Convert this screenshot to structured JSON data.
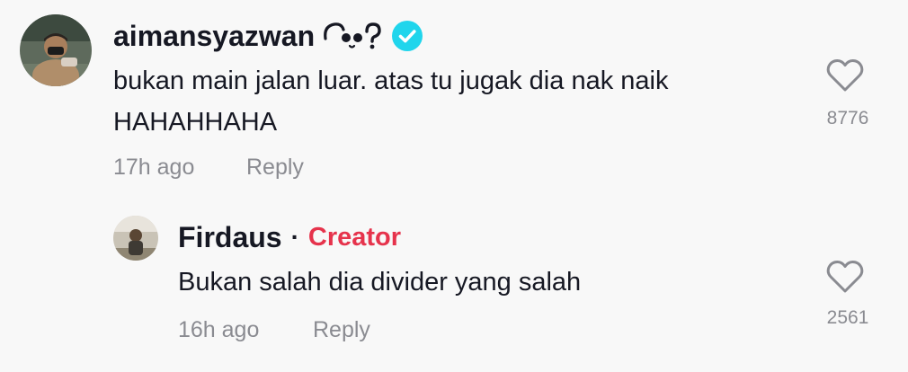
{
  "comments": [
    {
      "username": "aimansyazwan",
      "username_emoji_icon": "panda-face-icon",
      "verified_icon": "verified-badge-icon",
      "verified_color": "#20d5ec",
      "text_line1": "bukan main jalan luar. atas tu jugak dia nak naik",
      "text_line2": "HAHAHHAHA",
      "time": "17h ago",
      "reply_label": "Reply",
      "like_count": "8776",
      "like_icon": "heart-outline-icon"
    },
    {
      "username": "Firdaus",
      "separator": "·",
      "badge": "Creator",
      "badge_color": "#e6334c",
      "text": "Bukan salah dia divider yang salah",
      "time": "16h ago",
      "reply_label": "Reply",
      "like_count": "2561",
      "like_icon": "heart-outline-icon"
    }
  ]
}
